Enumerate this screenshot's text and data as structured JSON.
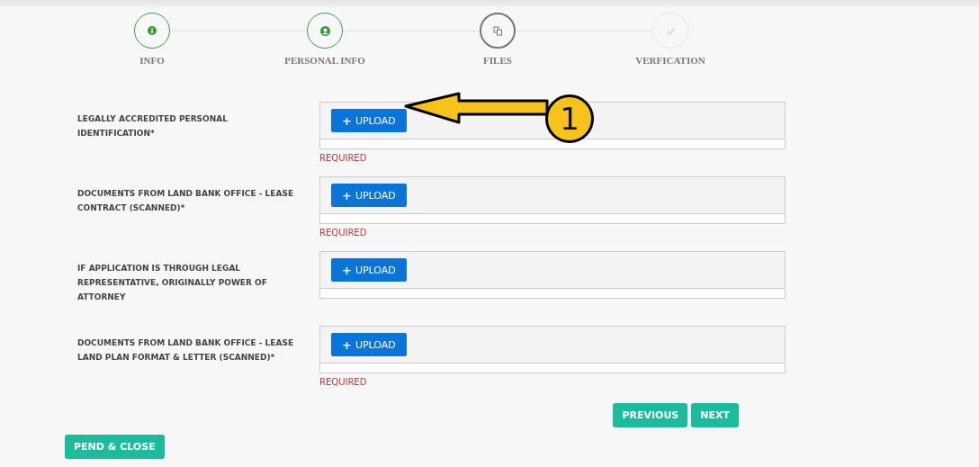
{
  "steps": [
    {
      "label": "INFO",
      "completed": true,
      "selected": false
    },
    {
      "label": "PERSONAL INFO",
      "completed": true,
      "selected": false
    },
    {
      "label": "FILES",
      "completed": false,
      "selected": true
    },
    {
      "label": "VERFICATION",
      "completed": false,
      "selected": false
    }
  ],
  "fields": [
    {
      "label": "LEGALLY ACCREDITED PERSONAL IDENTIFICATION*",
      "button": "UPLOAD",
      "button_icon": "+",
      "error": "REQUIRED",
      "annotation": "1"
    },
    {
      "label": "DOCUMENTS FROM LAND BANK OFFICE - LEASE CONTRACT (SCANNED)*",
      "button": "UPLOAD",
      "button_icon": "+",
      "error": "REQUIRED"
    },
    {
      "label": "IF APPLICATION IS THROUGH LEGAL REPRESENTATIVE, ORIGINALLY POWER OF ATTORNEY",
      "button": "UPLOAD",
      "button_icon": "+"
    },
    {
      "label": "DOCUMENTS FROM LAND BANK OFFICE - LEASE LAND PLAN FORMAT & LETTER (SCANNED)*",
      "button": "UPLOAD",
      "button_icon": "+",
      "error": "REQUIRED"
    }
  ],
  "nav_buttons": [
    "PREVIOUS",
    "NEXT"
  ],
  "pend_button": "PEND & CLOSE"
}
